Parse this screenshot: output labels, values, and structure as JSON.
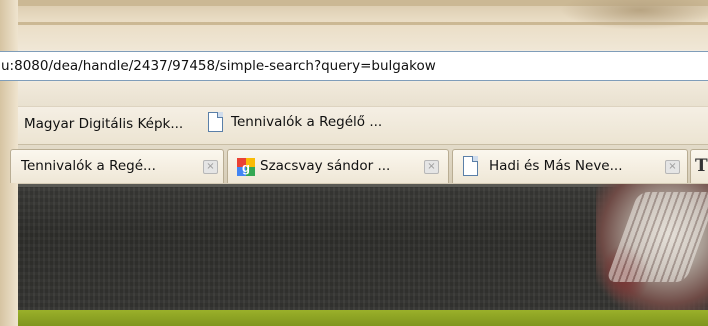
{
  "address_bar": {
    "url": "u:8080/dea/handle/2437/97458/simple-search?query=bulgakow"
  },
  "bookmarks": {
    "items": [
      {
        "label": "Magyar Digitális Képk...",
        "icon": "none"
      },
      {
        "label": "Tennivalók a Regélő ...",
        "icon": "page-icon"
      }
    ]
  },
  "tabs": [
    {
      "label": "Tennivalók a Regé...",
      "icon": "none",
      "close": "×"
    },
    {
      "label": "Szacsvay sándor ...",
      "icon": "google-icon",
      "close": "×"
    },
    {
      "label": "Hadi és Más Neve...",
      "icon": "page-icon",
      "close": "×"
    },
    {
      "label": "",
      "icon": "t-icon",
      "glyph": "T"
    }
  ],
  "colors": {
    "site_header": "#33332f",
    "accent_green": "#8ca424",
    "address_border": "#7f9db9"
  }
}
